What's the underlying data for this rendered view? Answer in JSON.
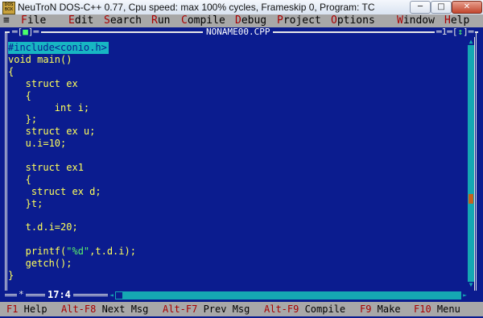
{
  "window": {
    "title": "NeuTroN DOS-C++ 0.77, Cpu speed: max 100% cycles, Frameskip  0, Program:     TC",
    "icon_text": "DOS BOX",
    "min": "─",
    "max": "□",
    "close": "✕"
  },
  "menu": {
    "system": "≡",
    "items": [
      {
        "hot": "F",
        "rest": "ile"
      },
      {
        "hot": "E",
        "rest": "dit"
      },
      {
        "hot": "S",
        "rest": "earch"
      },
      {
        "hot": "R",
        "rest": "un"
      },
      {
        "hot": "C",
        "rest": "ompile"
      },
      {
        "hot": "D",
        "rest": "ebug"
      },
      {
        "hot": "P",
        "rest": "roject"
      },
      {
        "hot": "O",
        "rest": "ptions"
      },
      {
        "hot": "W",
        "rest": "indow"
      },
      {
        "hot": "H",
        "rest": "elp"
      }
    ]
  },
  "editor": {
    "close_box_left": "═[",
    "close_box_mark": "■",
    "close_box_right": "]═",
    "filename": "NONAME00.CPP",
    "window_number": "═1═[",
    "zoom_mark": "↕",
    "window_number_end": "]═",
    "cursor_position": "17:4",
    "star": "*",
    "lines": [
      "#include<conio.h>",
      "void main()",
      "{",
      "   struct ex",
      "   {",
      "        int i;",
      "   };",
      "   struct ex u;",
      "   u.i=10;",
      "",
      "   struct ex1",
      "   {",
      "    struct ex d;",
      "   }t;",
      "",
      "   t.d.i=20;",
      "",
      "   printf(\"%d\",t.d.i);",
      "   getch();",
      "}"
    ],
    "printf_prefix": "   printf(",
    "printf_string": "\"%d\"",
    "printf_suffix": ",t.d.i);"
  },
  "status": [
    {
      "key": "F1",
      "label": " Help"
    },
    {
      "key": "Alt-F8",
      "label": " Next Msg"
    },
    {
      "key": "Alt-F7",
      "label": " Prev Msg"
    },
    {
      "key": "Alt-F9",
      "label": " Compile"
    },
    {
      "key": "F9",
      "label": " Make"
    },
    {
      "key": "F10",
      "label": " Menu"
    }
  ],
  "colors": {
    "editor_bg": "#0b1c8f",
    "code_text": "#ffff5a",
    "selection": "#17b6c3",
    "string_literal": "#59f06a",
    "menu_bg": "#a8a8a8",
    "hotkey": "#a80000"
  }
}
